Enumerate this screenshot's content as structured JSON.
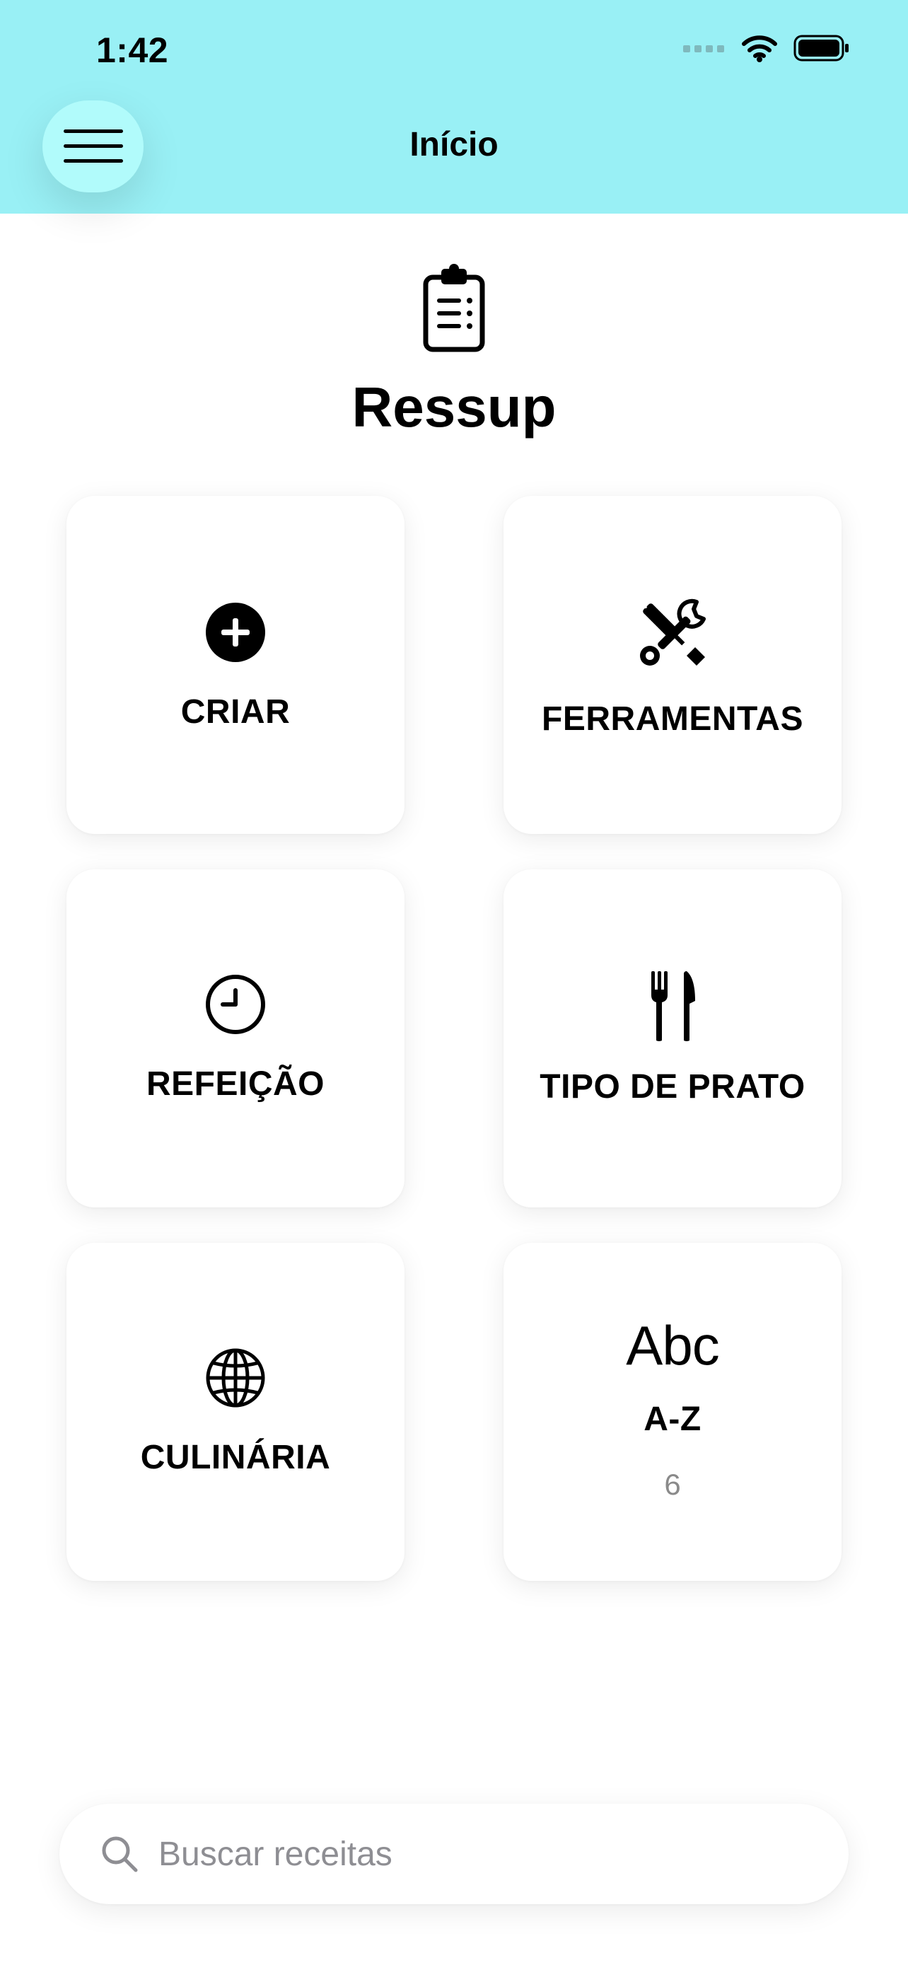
{
  "status_bar": {
    "time": "1:42",
    "icons": [
      "cellular-signal-icon",
      "wifi-icon",
      "battery-icon"
    ]
  },
  "header": {
    "title": "Início",
    "menu_icon": "hamburger-menu-icon",
    "background": "#99f0f5",
    "menu_button_color": "#b1fbfb"
  },
  "app": {
    "name": "Ressup",
    "logo_icon": "clipboard-list-icon"
  },
  "cards": {
    "create": {
      "label": "CRIAR",
      "icon": "plus-circle-icon"
    },
    "tools": {
      "label": "FERRAMENTAS",
      "icon": "wrench-screwdriver-icon"
    },
    "meal": {
      "label": "REFEIÇÃO",
      "icon": "clock-icon"
    },
    "dish_type": {
      "label": "TIPO DE PRATO",
      "icon": "fork-knife-icon"
    },
    "cuisine": {
      "label": "CULINÁRIA",
      "icon": "globe-icon"
    },
    "alphabetical": {
      "glyph": "Abc",
      "label": "A-Z",
      "count": "6"
    }
  },
  "search": {
    "placeholder": "Buscar receitas",
    "value": "",
    "icon": "search-icon"
  }
}
